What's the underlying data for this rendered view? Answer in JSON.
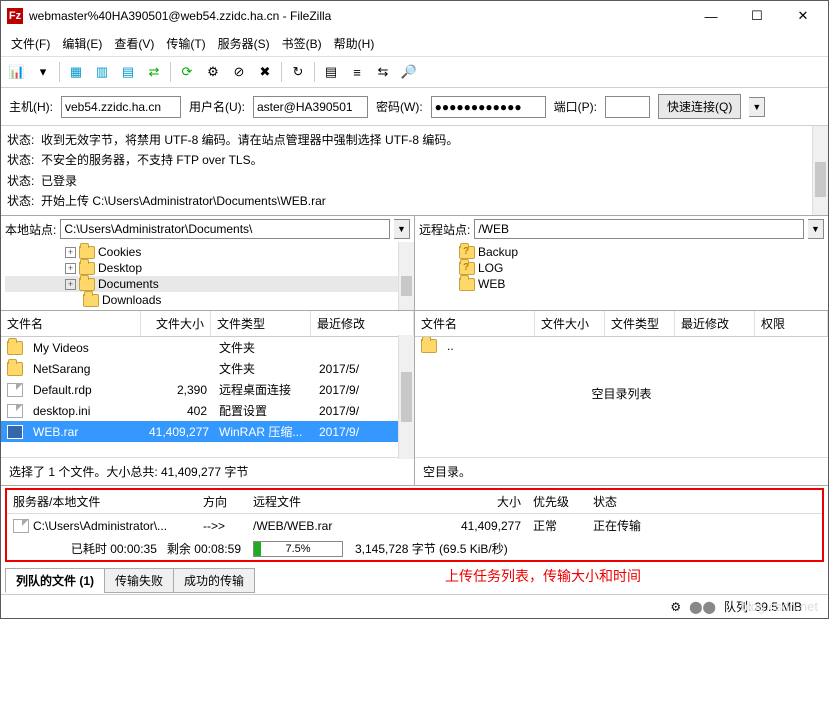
{
  "title": "webmaster%40HA390501@web54.zzidc.ha.cn - FileZilla",
  "menu": [
    "文件(F)",
    "编辑(E)",
    "查看(V)",
    "传输(T)",
    "服务器(S)",
    "书签(B)",
    "帮助(H)"
  ],
  "quick": {
    "host_label": "主机(H):",
    "host": "veb54.zzidc.ha.cn",
    "user_label": "用户名(U):",
    "user": "aster@HA390501",
    "pass_label": "密码(W):",
    "pass": "●●●●●●●●●●●●",
    "port_label": "端口(P):",
    "port": "",
    "connect": "快速连接(Q)"
  },
  "log": [
    {
      "l": "状态:",
      "t": "收到无效字节，将禁用 UTF-8 编码。请在站点管理器中强制选择 UTF-8 编码。"
    },
    {
      "l": "状态:",
      "t": "不安全的服务器，不支持 FTP over TLS。"
    },
    {
      "l": "状态:",
      "t": "已登录"
    },
    {
      "l": "状态:",
      "t": "开始上传 C:\\Users\\Administrator\\Documents\\WEB.rar"
    }
  ],
  "local": {
    "label": "本地站点:",
    "path": "C:\\Users\\Administrator\\Documents\\",
    "tree": [
      "Cookies",
      "Desktop",
      "Documents",
      "Downloads"
    ],
    "cols": {
      "name": "文件名",
      "size": "文件大小",
      "type": "文件类型",
      "mod": "最近修改"
    },
    "rows": [
      {
        "name": "My Videos",
        "size": "",
        "type": "文件夹",
        "mod": ""
      },
      {
        "name": "NetSarang",
        "size": "",
        "type": "文件夹",
        "mod": "2017/5/"
      },
      {
        "name": "Default.rdp",
        "size": "2,390",
        "type": "远程桌面连接",
        "mod": "2017/9/"
      },
      {
        "name": "desktop.ini",
        "size": "402",
        "type": "配置设置",
        "mod": "2017/9/"
      },
      {
        "name": "WEB.rar",
        "size": "41,409,277",
        "type": "WinRAR 压缩...",
        "mod": "2017/9/",
        "sel": true
      }
    ],
    "status": "选择了 1 个文件。大小总共: 41,409,277 字节"
  },
  "remote": {
    "label": "远程站点:",
    "path": "/WEB",
    "tree": [
      "Backup",
      "LOG",
      "WEB"
    ],
    "cols": {
      "name": "文件名",
      "size": "文件大小",
      "type": "文件类型",
      "mod": "最近修改",
      "perm": "权限"
    },
    "empty": "空目录列表",
    "status": "空目录。"
  },
  "transfer": {
    "cols": {
      "file": "服务器/本地文件",
      "dir": "方向",
      "remote": "远程文件",
      "size": "大小",
      "pri": "优先级",
      "status": "状态"
    },
    "file": "C:\\Users\\Administrator\\...",
    "dirArrow": "-->>",
    "remoteFile": "/WEB/WEB.rar",
    "size": "41,409,277",
    "pri": "正常",
    "state": "正在传输",
    "elapsed_l": "已耗时",
    "elapsed": "00:00:35",
    "remain_l": "剩余",
    "remain": "00:08:59",
    "pct": "7.5%",
    "pct_v": 7.5,
    "bytes": "3,145,728 字节 (69.5 KiB/秒)"
  },
  "tabs": {
    "queued": "列队的文件 (1)",
    "failed": "传输失败",
    "success": "成功的传输"
  },
  "annotation": "上传任务列表，传输大小和时间",
  "bottom": {
    "queue": "队列: 39.5 MiB"
  },
  "watermark": "blog.csdn.net"
}
